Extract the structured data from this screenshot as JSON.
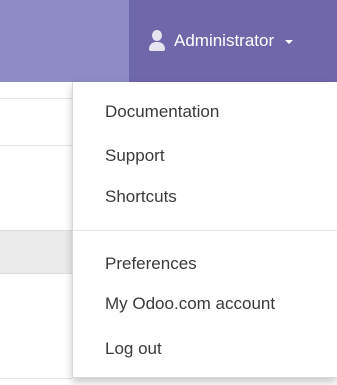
{
  "topbar": {
    "user_name": "Administrator",
    "user_icon": "user-icon",
    "caret_icon": "caret-down-icon"
  },
  "menu": {
    "group1": [
      "Documentation",
      "Support",
      "Shortcuts"
    ],
    "group2": [
      "Preferences",
      "My Odoo.com account",
      "Log out"
    ]
  },
  "colors": {
    "topbar": "#8f8bc4",
    "user_menu": "#6e68ab",
    "menu_text": "#3a3a3a"
  }
}
